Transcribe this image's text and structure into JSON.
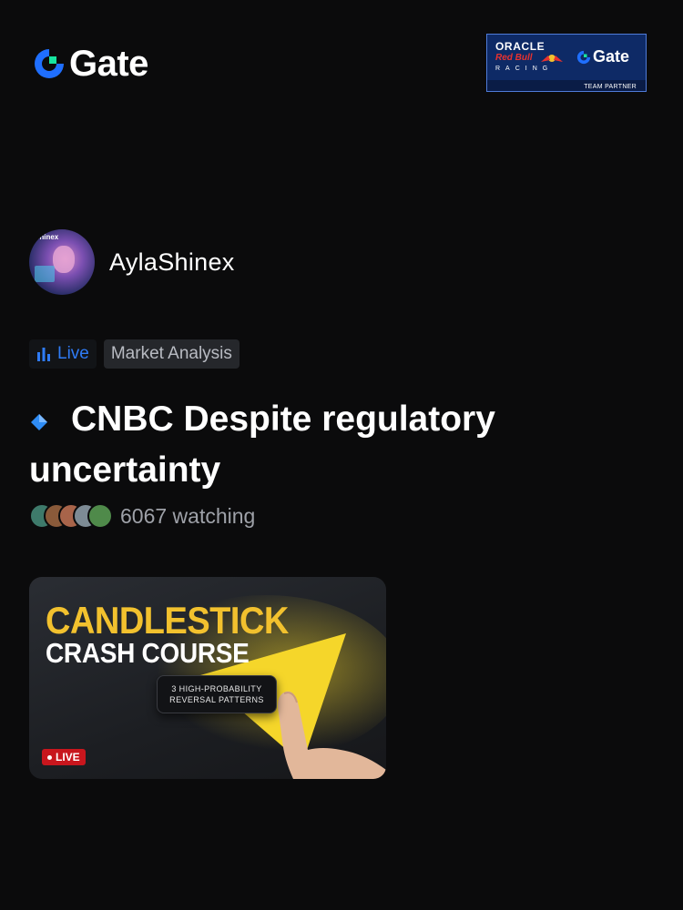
{
  "header": {
    "brand": "Gate",
    "partner": {
      "oracle": "ORACLE",
      "redbull": "Red Bull",
      "racing": "RACING",
      "brand": "Gate",
      "team_partner": "TEAM PARTNER"
    }
  },
  "author": {
    "avatar_tag": "Shinex",
    "name": "AylaShinex"
  },
  "tags": {
    "live": "Live",
    "topic": "Market Analysis"
  },
  "post": {
    "title": "CNBC Despite regulatory uncertainty"
  },
  "watchers": {
    "count_text": "6067 watching",
    "avatar_colors": [
      "#3e7a6b",
      "#8a5a3a",
      "#a8644a",
      "#7d8b95",
      "#4f8a4a"
    ]
  },
  "video": {
    "title_line1": "CANDLESTICK",
    "title_line2": "CRASH COURSE",
    "pill_line1": "3 HIGH-PROBABILITY",
    "pill_line2": "REVERSAL PATTERNS",
    "live_badge": "LIVE"
  },
  "colors": {
    "background": "#0b0b0c",
    "accent_blue": "#2f7bf5",
    "brand_green": "#17e5a0",
    "highlight_yellow": "#f2c12e",
    "live_red": "#c8161d"
  }
}
